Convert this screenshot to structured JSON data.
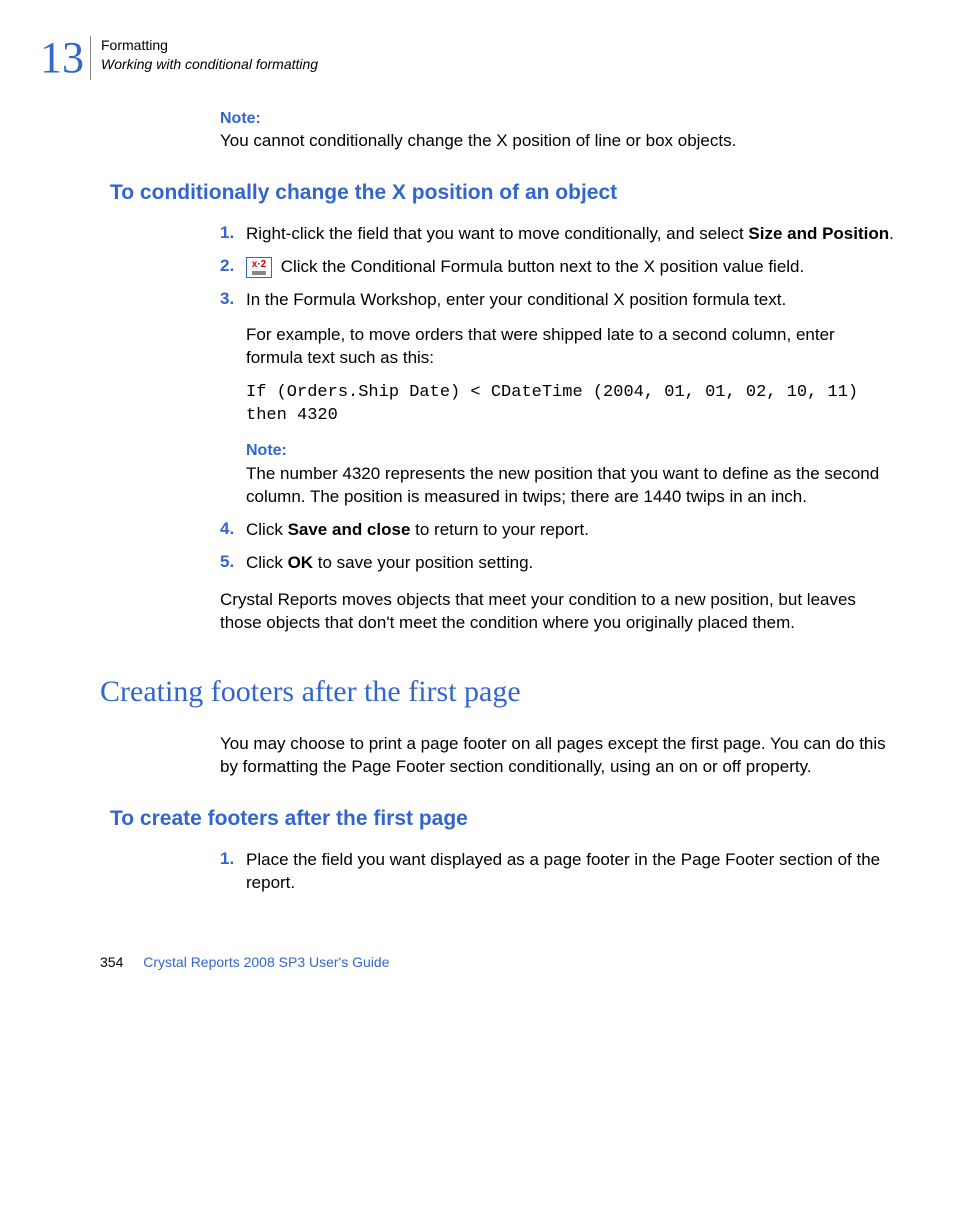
{
  "header": {
    "chapter_number": "13",
    "line1": "Formatting",
    "line2": "Working with conditional formatting"
  },
  "note1": {
    "label": "Note:",
    "text": "You cannot conditionally change the X position of line or box objects."
  },
  "heading1": "To conditionally change the X position of an object",
  "steps1": {
    "s1": {
      "num": "1.",
      "pre": "Right-click the field that you want to move conditionally, and select ",
      "bold": "Size and Position",
      "post": "."
    },
    "s2": {
      "num": "2.",
      "text": " Click the Conditional Formula button next to the X position value field."
    },
    "s3": {
      "num": "3.",
      "line1": "In the Formula Workshop, enter your conditional X position formula text.",
      "line2": "For example, to move orders that were shipped late to a second column, enter formula text such as this:",
      "code": "If (Orders.Ship Date) < CDateTime (2004, 01, 01, 02, 10, 11) then 4320",
      "note_label": "Note:",
      "note_text": "The number 4320 represents the new position that you want to define as the second column. The position is measured in twips; there are 1440 twips in an inch."
    },
    "s4": {
      "num": "4.",
      "pre": "Click ",
      "bold": "Save and close",
      "post": " to return to your report."
    },
    "s5": {
      "num": "5.",
      "pre": "Click ",
      "bold": "OK",
      "post": " to save your position setting."
    }
  },
  "after_steps1": "Crystal Reports moves objects that meet your condition to a new position, but leaves those objects that don't meet the condition where you originally placed them.",
  "heading2": "Creating footers after the first page",
  "section2_intro": "You may choose to print a page footer on all pages except the first page. You can do this by formatting the Page Footer section conditionally, using an on or off property.",
  "heading3": "To create footers after the first page",
  "steps2": {
    "s1": {
      "num": "1.",
      "text": "Place the field you want displayed as a page footer in the Page Footer section of the report."
    }
  },
  "footer": {
    "page": "354",
    "title": "Crystal Reports 2008 SP3 User's Guide"
  },
  "icon": {
    "label": "x·2"
  }
}
